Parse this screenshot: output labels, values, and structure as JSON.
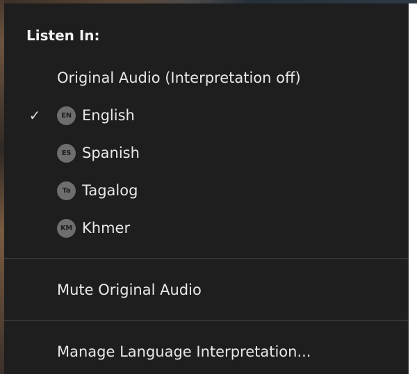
{
  "menu": {
    "title": "Listen In:",
    "original_audio": "Original Audio (Interpretation off)",
    "check_mark": "✓",
    "languages": [
      {
        "code": "EN",
        "label": "English",
        "selected": true
      },
      {
        "code": "ES",
        "label": "Spanish",
        "selected": false
      },
      {
        "code": "Ta",
        "label": "Tagalog",
        "selected": false
      },
      {
        "code": "KM",
        "label": "Khmer",
        "selected": false
      }
    ],
    "mute_original_audio": "Mute Original Audio",
    "manage_interpretation": "Manage Language Interpretation..."
  },
  "colors": {
    "menu_background": "#1e1e1e",
    "text": "#e8e8e8",
    "badge_background": "#6e6e6e",
    "divider": "#343434"
  }
}
